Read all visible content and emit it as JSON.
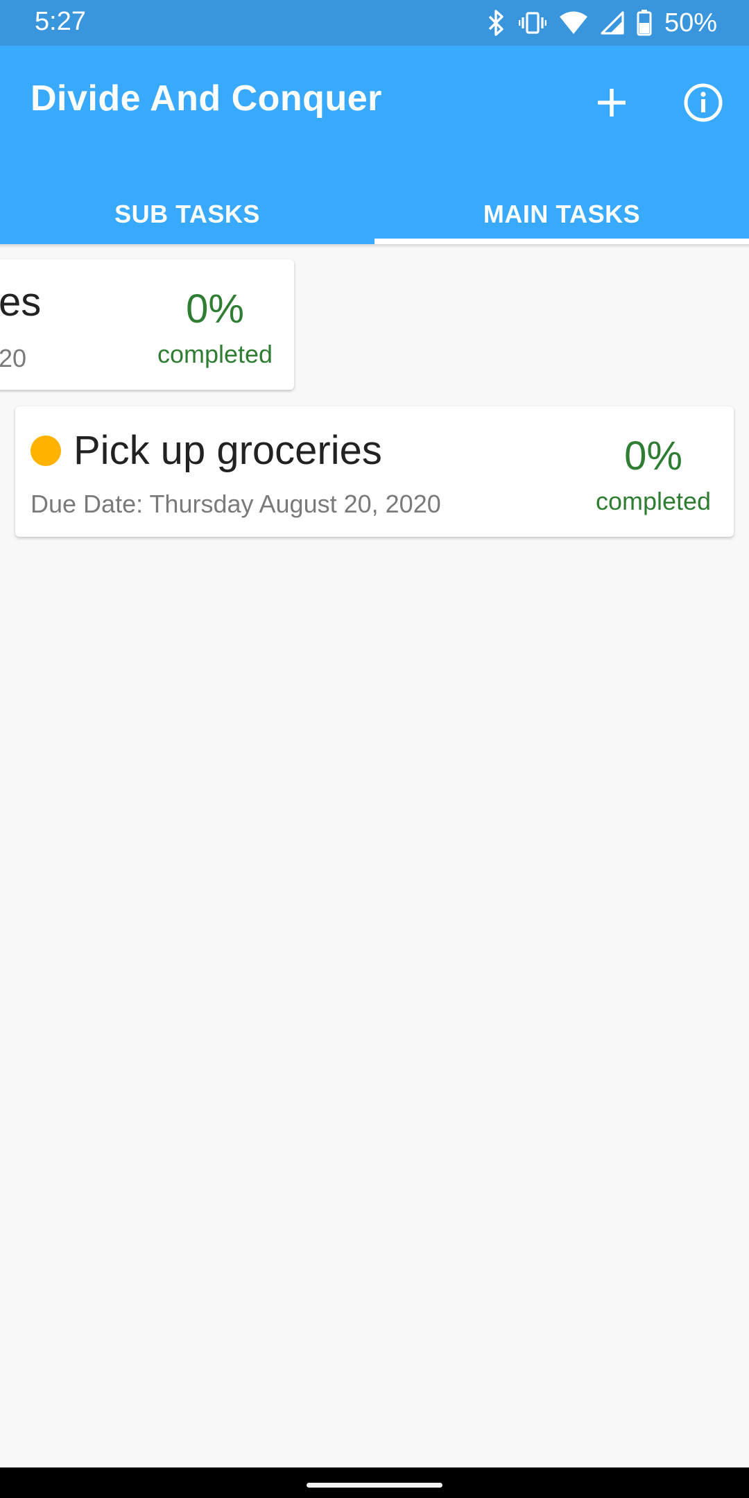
{
  "status_bar": {
    "time": "5:27",
    "battery": "50%",
    "icons": [
      "bluetooth-icon",
      "vibrate-icon",
      "wifi-icon",
      "cell-signal-icon",
      "battery-icon"
    ]
  },
  "app_bar": {
    "title": "Divide And Conquer",
    "actions": [
      "add-icon",
      "info-icon"
    ]
  },
  "tabs": [
    {
      "label": "SUB TASKS",
      "selected": false
    },
    {
      "label": "MAIN TASKS",
      "selected": true
    }
  ],
  "task_cards": [
    {
      "title_visible": "es",
      "due_visible": "20",
      "percent": "0%",
      "percent_label": "completed"
    },
    {
      "title": "Pick up groceries",
      "due": "Due Date: Thursday August 20, 2020",
      "percent": "0%",
      "percent_label": "completed",
      "status_color": "#ffb300"
    }
  ],
  "colors": {
    "status_bar": "#3a96dc",
    "app_bar": "#39aafb",
    "progress_text": "#2e7d32",
    "status_dot": "#ffb300"
  }
}
